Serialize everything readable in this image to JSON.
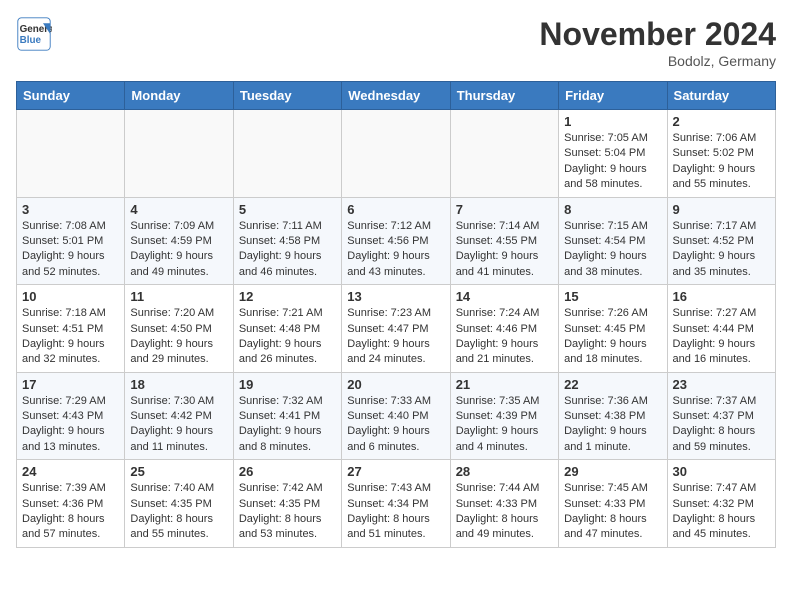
{
  "header": {
    "logo_line1": "General",
    "logo_line2": "Blue",
    "month_title": "November 2024",
    "location": "Bodolz, Germany"
  },
  "weekdays": [
    "Sunday",
    "Monday",
    "Tuesday",
    "Wednesday",
    "Thursday",
    "Friday",
    "Saturday"
  ],
  "weeks": [
    [
      {
        "day": "",
        "info": ""
      },
      {
        "day": "",
        "info": ""
      },
      {
        "day": "",
        "info": ""
      },
      {
        "day": "",
        "info": ""
      },
      {
        "day": "",
        "info": ""
      },
      {
        "day": "1",
        "info": "Sunrise: 7:05 AM\nSunset: 5:04 PM\nDaylight: 9 hours and 58 minutes."
      },
      {
        "day": "2",
        "info": "Sunrise: 7:06 AM\nSunset: 5:02 PM\nDaylight: 9 hours and 55 minutes."
      }
    ],
    [
      {
        "day": "3",
        "info": "Sunrise: 7:08 AM\nSunset: 5:01 PM\nDaylight: 9 hours and 52 minutes."
      },
      {
        "day": "4",
        "info": "Sunrise: 7:09 AM\nSunset: 4:59 PM\nDaylight: 9 hours and 49 minutes."
      },
      {
        "day": "5",
        "info": "Sunrise: 7:11 AM\nSunset: 4:58 PM\nDaylight: 9 hours and 46 minutes."
      },
      {
        "day": "6",
        "info": "Sunrise: 7:12 AM\nSunset: 4:56 PM\nDaylight: 9 hours and 43 minutes."
      },
      {
        "day": "7",
        "info": "Sunrise: 7:14 AM\nSunset: 4:55 PM\nDaylight: 9 hours and 41 minutes."
      },
      {
        "day": "8",
        "info": "Sunrise: 7:15 AM\nSunset: 4:54 PM\nDaylight: 9 hours and 38 minutes."
      },
      {
        "day": "9",
        "info": "Sunrise: 7:17 AM\nSunset: 4:52 PM\nDaylight: 9 hours and 35 minutes."
      }
    ],
    [
      {
        "day": "10",
        "info": "Sunrise: 7:18 AM\nSunset: 4:51 PM\nDaylight: 9 hours and 32 minutes."
      },
      {
        "day": "11",
        "info": "Sunrise: 7:20 AM\nSunset: 4:50 PM\nDaylight: 9 hours and 29 minutes."
      },
      {
        "day": "12",
        "info": "Sunrise: 7:21 AM\nSunset: 4:48 PM\nDaylight: 9 hours and 26 minutes."
      },
      {
        "day": "13",
        "info": "Sunrise: 7:23 AM\nSunset: 4:47 PM\nDaylight: 9 hours and 24 minutes."
      },
      {
        "day": "14",
        "info": "Sunrise: 7:24 AM\nSunset: 4:46 PM\nDaylight: 9 hours and 21 minutes."
      },
      {
        "day": "15",
        "info": "Sunrise: 7:26 AM\nSunset: 4:45 PM\nDaylight: 9 hours and 18 minutes."
      },
      {
        "day": "16",
        "info": "Sunrise: 7:27 AM\nSunset: 4:44 PM\nDaylight: 9 hours and 16 minutes."
      }
    ],
    [
      {
        "day": "17",
        "info": "Sunrise: 7:29 AM\nSunset: 4:43 PM\nDaylight: 9 hours and 13 minutes."
      },
      {
        "day": "18",
        "info": "Sunrise: 7:30 AM\nSunset: 4:42 PM\nDaylight: 9 hours and 11 minutes."
      },
      {
        "day": "19",
        "info": "Sunrise: 7:32 AM\nSunset: 4:41 PM\nDaylight: 9 hours and 8 minutes."
      },
      {
        "day": "20",
        "info": "Sunrise: 7:33 AM\nSunset: 4:40 PM\nDaylight: 9 hours and 6 minutes."
      },
      {
        "day": "21",
        "info": "Sunrise: 7:35 AM\nSunset: 4:39 PM\nDaylight: 9 hours and 4 minutes."
      },
      {
        "day": "22",
        "info": "Sunrise: 7:36 AM\nSunset: 4:38 PM\nDaylight: 9 hours and 1 minute."
      },
      {
        "day": "23",
        "info": "Sunrise: 7:37 AM\nSunset: 4:37 PM\nDaylight: 8 hours and 59 minutes."
      }
    ],
    [
      {
        "day": "24",
        "info": "Sunrise: 7:39 AM\nSunset: 4:36 PM\nDaylight: 8 hours and 57 minutes."
      },
      {
        "day": "25",
        "info": "Sunrise: 7:40 AM\nSunset: 4:35 PM\nDaylight: 8 hours and 55 minutes."
      },
      {
        "day": "26",
        "info": "Sunrise: 7:42 AM\nSunset: 4:35 PM\nDaylight: 8 hours and 53 minutes."
      },
      {
        "day": "27",
        "info": "Sunrise: 7:43 AM\nSunset: 4:34 PM\nDaylight: 8 hours and 51 minutes."
      },
      {
        "day": "28",
        "info": "Sunrise: 7:44 AM\nSunset: 4:33 PM\nDaylight: 8 hours and 49 minutes."
      },
      {
        "day": "29",
        "info": "Sunrise: 7:45 AM\nSunset: 4:33 PM\nDaylight: 8 hours and 47 minutes."
      },
      {
        "day": "30",
        "info": "Sunrise: 7:47 AM\nSunset: 4:32 PM\nDaylight: 8 hours and 45 minutes."
      }
    ]
  ]
}
